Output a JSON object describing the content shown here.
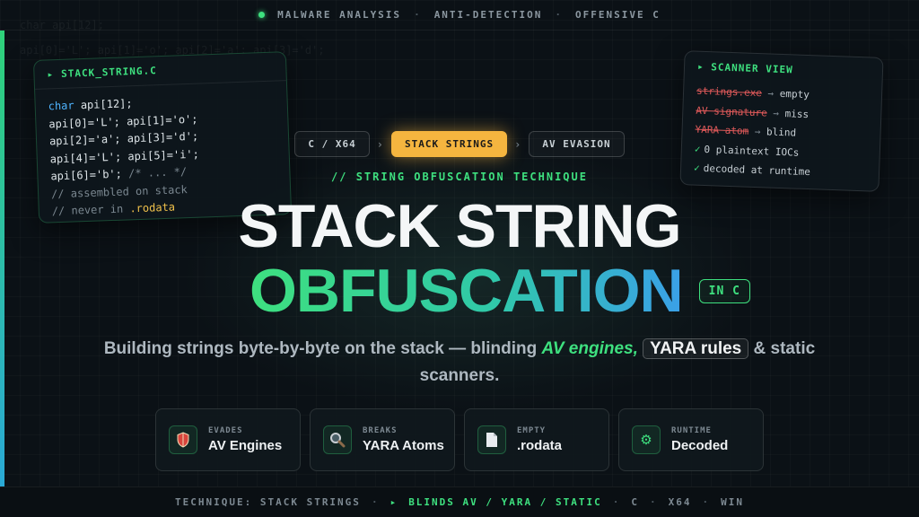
{
  "background_code": "char api[12];\napi[0]='L'; api[1]='o'; api[2]='a'; api[3]='d';",
  "top_banner": {
    "items": [
      "MALWARE ANALYSIS",
      "ANTI-DETECTION",
      "OFFENSIVE C"
    ]
  },
  "code_card": {
    "filename": "STACK_STRING.C",
    "lines": {
      "l1_kw": "char",
      "l1_rest": " api[12];",
      "l2": "api[0]='L'; api[1]='o';",
      "l3": "api[2]='a'; api[3]='d';",
      "l4": "api[4]='L'; api[5]='i';",
      "l5_code": "api[6]='b'; ",
      "l5_comment": "/* ... */",
      "l6": "// assembled on stack",
      "l7_pre": "// never in ",
      "l7_hl": ".rodata"
    }
  },
  "scanner_card": {
    "title": "SCANNER VIEW",
    "rows": [
      {
        "struck": "strings.exe",
        "arrow": "→",
        "result": "empty"
      },
      {
        "struck": "AV signature",
        "arrow": "→",
        "result": "miss"
      },
      {
        "struck": "YARA atom",
        "arrow": "→",
        "result": "blind"
      }
    ],
    "checks": [
      "0 plaintext IOCs",
      "decoded at runtime"
    ]
  },
  "pills": [
    "C / X64",
    "STACK STRINGS",
    "AV EVASION"
  ],
  "kicker": "// STRING OBFUSCATION TECHNIQUE",
  "title_line1": "STACK STRING",
  "title_line2": "OBFUSCATION",
  "lang_badge": "IN C",
  "subtitle": {
    "part1": "Building strings byte-by-byte on the stack — blinding ",
    "av": "AV engines,",
    "yara": "YARA rules",
    "part2": " & static scanners."
  },
  "stats": [
    {
      "icon": "shield-icon",
      "label": "EVADES",
      "value": "AV Engines"
    },
    {
      "icon": "magnifier-icon",
      "label": "BREAKS",
      "value": "YARA Atoms"
    },
    {
      "icon": "document-icon",
      "label": "EMPTY",
      "value": ".rodata"
    },
    {
      "icon": "gear-icon",
      "label": "RUNTIME",
      "value": "Decoded"
    }
  ],
  "bottom_banner": {
    "technique": "TECHNIQUE: STACK STRINGS",
    "highlight": "BLINDS AV / YARA / STATIC",
    "tags": [
      "C",
      "X64",
      "WIN"
    ]
  },
  "colors": {
    "accent": "#3ee07f",
    "amber": "#f5b53f",
    "blue": "#3aa0e8",
    "red": "#e05a5a"
  }
}
